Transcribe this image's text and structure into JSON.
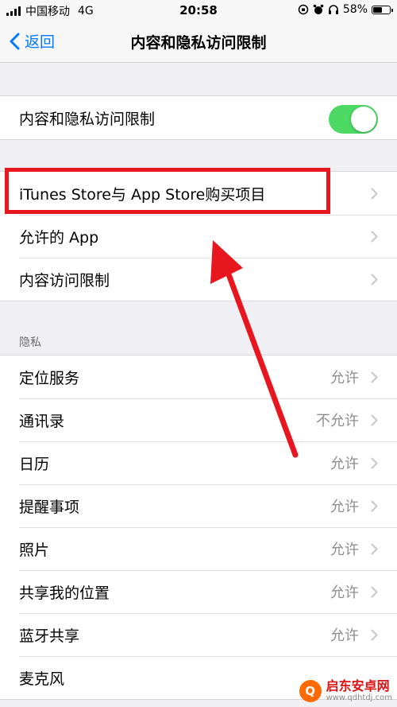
{
  "status_bar": {
    "carrier": "中国移动",
    "network": "4G",
    "time": "20:58",
    "battery_percent": "58%",
    "battery_level": 0.58
  },
  "nav": {
    "back_label": "返回",
    "title": "内容和隐私访问限制"
  },
  "toggle_row": {
    "label": "内容和隐私访问限制",
    "enabled": true,
    "accent": "#4cd964"
  },
  "restrictions": {
    "items": [
      {
        "label": "iTunes Store与 App Store购买项目"
      },
      {
        "label": "允许的 App"
      },
      {
        "label": "内容访问限制"
      }
    ]
  },
  "privacy": {
    "header": "隐私",
    "items": [
      {
        "label": "定位服务",
        "value": "允许"
      },
      {
        "label": "通讯录",
        "value": "不允许"
      },
      {
        "label": "日历",
        "value": "允许"
      },
      {
        "label": "提醒事项",
        "value": "允许"
      },
      {
        "label": "照片",
        "value": "允许"
      },
      {
        "label": "共享我的位置",
        "value": "允许"
      },
      {
        "label": "蓝牙共享",
        "value": "允许"
      },
      {
        "label": "麦克风",
        "value": ""
      }
    ]
  },
  "colors": {
    "tint": "#007aff",
    "annotation": "#e8161f"
  },
  "watermark": {
    "name": "启东安卓网",
    "url": "www.qdhtdj.com"
  }
}
